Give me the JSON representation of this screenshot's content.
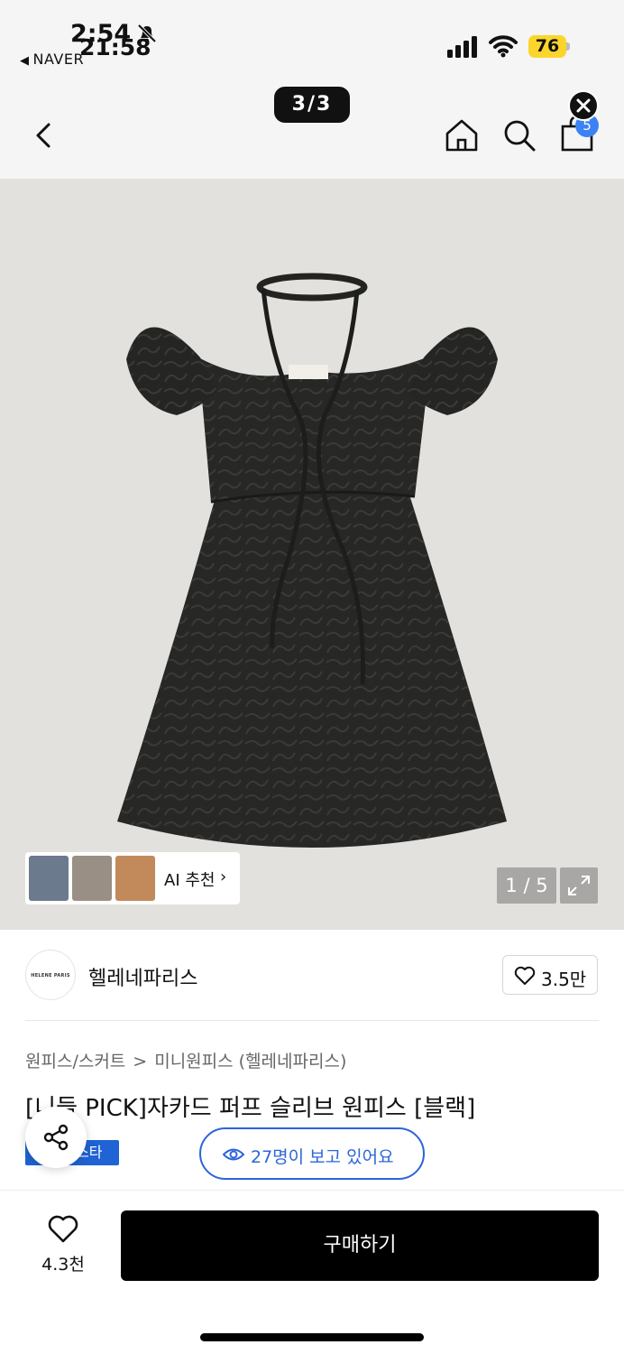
{
  "status_bar": {
    "time_back": "2:54",
    "time_front": "21:58",
    "back_app": "NAVER",
    "battery_pct": "76",
    "colors": {
      "battery": "#fcd52c"
    }
  },
  "nav": {
    "page_indicator": "3/3",
    "cart_count": "5"
  },
  "gallery": {
    "ai_recommend_label": "AI 추천",
    "image_counter": "1 / 5"
  },
  "seller": {
    "logo_text": "HELENE PARIS",
    "name": "헬레네파리스",
    "likes": "3.5만"
  },
  "product": {
    "breadcrumb": [
      "원피스/스커트",
      "미니원피스 (헬레네파리스)"
    ],
    "breadcrumb_separator": ">",
    "title": "[니들 PICK]자카드 퍼프 슬리브 원피스 [블랙]",
    "tag": "스타",
    "viewers": "27명이 보고 있어요"
  },
  "bottom": {
    "wish_count": "4.3천",
    "buy_label": "구매하기"
  },
  "icons": {
    "back": "chevron-left-icon",
    "home": "home-icon",
    "search": "search-icon",
    "cart": "shopping-bag-icon",
    "close": "close-icon",
    "share": "share-icon",
    "eye": "eye-icon",
    "heart": "heart-icon",
    "expand": "expand-icon"
  },
  "colors": {
    "accent_blue": "#2b65d9",
    "buy_button": "#000000",
    "image_background": "#e2e1dd"
  }
}
